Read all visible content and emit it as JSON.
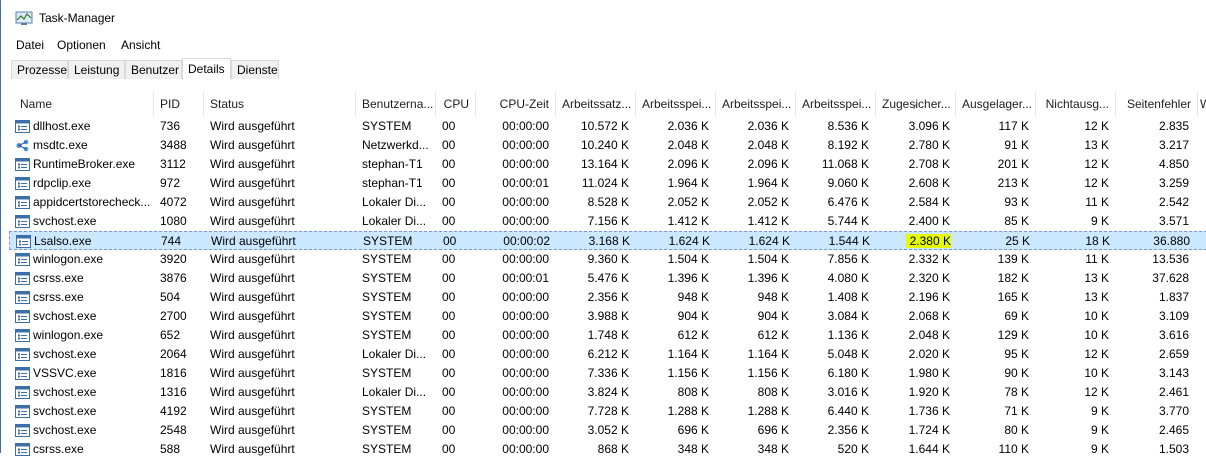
{
  "window": {
    "title": "Task-Manager"
  },
  "menu": [
    "Datei",
    "Optionen",
    "Ansicht"
  ],
  "tabs": [
    "Prozesse",
    "Leistung",
    "Benutzer",
    "Details",
    "Dienste"
  ],
  "active_tab": "Details",
  "columns": [
    "Name",
    "PID",
    "Status",
    "Benutzerna...",
    "CPU",
    "CPU-Zeit",
    "Arbeitssatz...",
    "Arbeitsspei...",
    "Arbeitsspei...",
    "Arbeitsspei...",
    "Zugesicher...",
    "Ausgelager...",
    "Nichtausg...",
    "Seitenfehler",
    "W"
  ],
  "rows": [
    {
      "icon": "window-process-icon",
      "name": "dllhost.exe",
      "pid": "736",
      "status": "Wird ausgeführt",
      "user": "SYSTEM",
      "cpu": "00",
      "time": "00:00:00",
      "ws": "10.572 K",
      "ws2": "2.036 K",
      "ws3": "2.036 K",
      "ws4": "8.536 K",
      "commit": "3.096 K",
      "paged": "117 K",
      "nonpaged": "12 K",
      "faults": "2.835"
    },
    {
      "icon": "network-process-icon",
      "name": "msdtc.exe",
      "pid": "3488",
      "status": "Wird ausgeführt",
      "user": "Netzwerkd...",
      "cpu": "00",
      "time": "00:00:00",
      "ws": "10.240 K",
      "ws2": "2.048 K",
      "ws3": "2.048 K",
      "ws4": "8.192 K",
      "commit": "2.780 K",
      "paged": "91 K",
      "nonpaged": "13 K",
      "faults": "3.217"
    },
    {
      "icon": "window-process-icon",
      "name": "RuntimeBroker.exe",
      "pid": "3112",
      "status": "Wird ausgeführt",
      "user": "stephan-T1",
      "cpu": "00",
      "time": "00:00:00",
      "ws": "13.164 K",
      "ws2": "2.096 K",
      "ws3": "2.096 K",
      "ws4": "11.068 K",
      "commit": "2.708 K",
      "paged": "201 K",
      "nonpaged": "12 K",
      "faults": "4.850"
    },
    {
      "icon": "window-process-icon",
      "name": "rdpclip.exe",
      "pid": "972",
      "status": "Wird ausgeführt",
      "user": "stephan-T1",
      "cpu": "00",
      "time": "00:00:01",
      "ws": "11.024 K",
      "ws2": "1.964 K",
      "ws3": "1.964 K",
      "ws4": "9.060 K",
      "commit": "2.608 K",
      "paged": "213 K",
      "nonpaged": "12 K",
      "faults": "3.259"
    },
    {
      "icon": "window-process-icon",
      "name": "appidcertstorecheck...",
      "pid": "4072",
      "status": "Wird ausgeführt",
      "user": "Lokaler Di...",
      "cpu": "00",
      "time": "00:00:00",
      "ws": "8.528 K",
      "ws2": "2.052 K",
      "ws3": "2.052 K",
      "ws4": "6.476 K",
      "commit": "2.584 K",
      "paged": "93 K",
      "nonpaged": "11 K",
      "faults": "2.542"
    },
    {
      "icon": "window-process-icon",
      "name": "svchost.exe",
      "pid": "1080",
      "status": "Wird ausgeführt",
      "user": "Lokaler Di...",
      "cpu": "00",
      "time": "00:00:00",
      "ws": "7.156 K",
      "ws2": "1.412 K",
      "ws3": "1.412 K",
      "ws4": "5.744 K",
      "commit": "2.400 K",
      "paged": "85 K",
      "nonpaged": "9 K",
      "faults": "3.571"
    },
    {
      "icon": "window-process-icon",
      "name": "Lsalso.exe",
      "pid": "744",
      "status": "Wird ausgeführt",
      "user": "SYSTEM",
      "cpu": "00",
      "time": "00:00:02",
      "ws": "3.168 K",
      "ws2": "1.624 K",
      "ws3": "1.624 K",
      "ws4": "1.544 K",
      "commit": "2.380 K",
      "paged": "25 K",
      "nonpaged": "18 K",
      "faults": "36.880",
      "selected": true
    },
    {
      "icon": "window-process-icon",
      "name": "winlogon.exe",
      "pid": "3920",
      "status": "Wird ausgeführt",
      "user": "SYSTEM",
      "cpu": "00",
      "time": "00:00:00",
      "ws": "9.360 K",
      "ws2": "1.504 K",
      "ws3": "1.504 K",
      "ws4": "7.856 K",
      "commit": "2.332 K",
      "paged": "139 K",
      "nonpaged": "11 K",
      "faults": "13.536"
    },
    {
      "icon": "window-process-icon",
      "name": "csrss.exe",
      "pid": "3876",
      "status": "Wird ausgeführt",
      "user": "SYSTEM",
      "cpu": "00",
      "time": "00:00:01",
      "ws": "5.476 K",
      "ws2": "1.396 K",
      "ws3": "1.396 K",
      "ws4": "4.080 K",
      "commit": "2.320 K",
      "paged": "182 K",
      "nonpaged": "13 K",
      "faults": "37.628"
    },
    {
      "icon": "window-process-icon",
      "name": "csrss.exe",
      "pid": "504",
      "status": "Wird ausgeführt",
      "user": "SYSTEM",
      "cpu": "00",
      "time": "00:00:00",
      "ws": "2.356 K",
      "ws2": "948 K",
      "ws3": "948 K",
      "ws4": "1.408 K",
      "commit": "2.196 K",
      "paged": "165 K",
      "nonpaged": "13 K",
      "faults": "1.837"
    },
    {
      "icon": "window-process-icon",
      "name": "svchost.exe",
      "pid": "2700",
      "status": "Wird ausgeführt",
      "user": "SYSTEM",
      "cpu": "00",
      "time": "00:00:00",
      "ws": "3.988 K",
      "ws2": "904 K",
      "ws3": "904 K",
      "ws4": "3.084 K",
      "commit": "2.068 K",
      "paged": "69 K",
      "nonpaged": "10 K",
      "faults": "3.109"
    },
    {
      "icon": "window-process-icon",
      "name": "winlogon.exe",
      "pid": "652",
      "status": "Wird ausgeführt",
      "user": "SYSTEM",
      "cpu": "00",
      "time": "00:00:00",
      "ws": "1.748 K",
      "ws2": "612 K",
      "ws3": "612 K",
      "ws4": "1.136 K",
      "commit": "2.048 K",
      "paged": "129 K",
      "nonpaged": "10 K",
      "faults": "3.616"
    },
    {
      "icon": "window-process-icon",
      "name": "svchost.exe",
      "pid": "2064",
      "status": "Wird ausgeführt",
      "user": "Lokaler Di...",
      "cpu": "00",
      "time": "00:00:00",
      "ws": "6.212 K",
      "ws2": "1.164 K",
      "ws3": "1.164 K",
      "ws4": "5.048 K",
      "commit": "2.020 K",
      "paged": "95 K",
      "nonpaged": "12 K",
      "faults": "2.659"
    },
    {
      "icon": "window-process-icon",
      "name": "VSSVC.exe",
      "pid": "1816",
      "status": "Wird ausgeführt",
      "user": "SYSTEM",
      "cpu": "00",
      "time": "00:00:00",
      "ws": "7.336 K",
      "ws2": "1.156 K",
      "ws3": "1.156 K",
      "ws4": "6.180 K",
      "commit": "1.980 K",
      "paged": "90 K",
      "nonpaged": "10 K",
      "faults": "3.143"
    },
    {
      "icon": "window-process-icon",
      "name": "svchost.exe",
      "pid": "1316",
      "status": "Wird ausgeführt",
      "user": "Lokaler Di...",
      "cpu": "00",
      "time": "00:00:00",
      "ws": "3.824 K",
      "ws2": "808 K",
      "ws3": "808 K",
      "ws4": "3.016 K",
      "commit": "1.920 K",
      "paged": "78 K",
      "nonpaged": "12 K",
      "faults": "2.461"
    },
    {
      "icon": "window-process-icon",
      "name": "svchost.exe",
      "pid": "4192",
      "status": "Wird ausgeführt",
      "user": "SYSTEM",
      "cpu": "00",
      "time": "00:00:00",
      "ws": "7.728 K",
      "ws2": "1.288 K",
      "ws3": "1.288 K",
      "ws4": "6.440 K",
      "commit": "1.736 K",
      "paged": "71 K",
      "nonpaged": "9 K",
      "faults": "3.770"
    },
    {
      "icon": "window-process-icon",
      "name": "svchost.exe",
      "pid": "2548",
      "status": "Wird ausgeführt",
      "user": "SYSTEM",
      "cpu": "00",
      "time": "00:00:00",
      "ws": "3.052 K",
      "ws2": "696 K",
      "ws3": "696 K",
      "ws4": "2.356 K",
      "commit": "1.724 K",
      "paged": "80 K",
      "nonpaged": "9 K",
      "faults": "2.465"
    },
    {
      "icon": "window-process-icon",
      "name": "csrss.exe",
      "pid": "588",
      "status": "Wird ausgeführt",
      "user": "SYSTEM",
      "cpu": "00",
      "time": "00:00:00",
      "ws": "868 K",
      "ws2": "348 K",
      "ws3": "348 K",
      "ws4": "520 K",
      "commit": "1.644 K",
      "paged": "110 K",
      "nonpaged": "9 K",
      "faults": "1.503"
    }
  ],
  "colors": {
    "selected_bg": "#cce8ff",
    "highlight": "#e5ff00"
  }
}
